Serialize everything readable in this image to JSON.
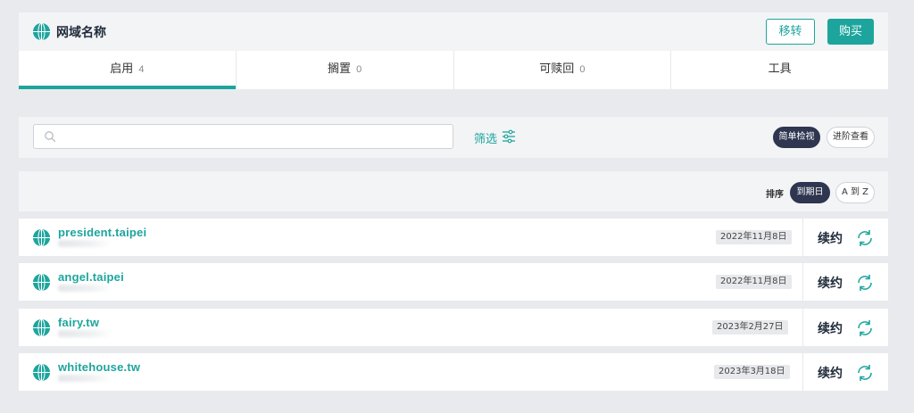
{
  "header": {
    "title": "网域名称",
    "transfer_label": "移转",
    "buy_label": "购买"
  },
  "tabs": [
    {
      "label": "启用",
      "count": "4",
      "active": true
    },
    {
      "label": "搁置",
      "count": "0",
      "active": false
    },
    {
      "label": "可赎回",
      "count": "0",
      "active": false
    },
    {
      "label": "工具",
      "count": "",
      "active": false
    }
  ],
  "filter": {
    "search_placeholder": "",
    "filter_label": "筛选",
    "view_simple": "简单检视",
    "view_advanced": "进阶查看"
  },
  "sort": {
    "label": "排序",
    "by_date": "到期日",
    "by_az": "A 到 Z"
  },
  "domains": [
    {
      "name": "president.taipei",
      "expiry": "2022年11月8日",
      "renew_label": "续约"
    },
    {
      "name": "angel.taipei",
      "expiry": "2022年11月8日",
      "renew_label": "续约"
    },
    {
      "name": "fairy.tw",
      "expiry": "2023年2月27日",
      "renew_label": "续约"
    },
    {
      "name": "whitehouse.tw",
      "expiry": "2023年3月18日",
      "renew_label": "续约"
    }
  ],
  "colors": {
    "accent": "#1da59d",
    "dark_pill": "#2f3650",
    "background": "#e8eaed"
  },
  "icons": {
    "domain": "globe-icon",
    "search": "search-icon",
    "filter": "sliders-icon",
    "renew": "refresh-icon"
  }
}
